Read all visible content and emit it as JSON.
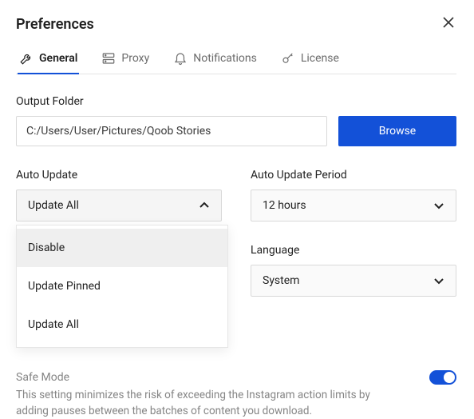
{
  "window": {
    "title": "Preferences"
  },
  "tabs": [
    {
      "id": "general",
      "label": "General",
      "icon": "wrench-icon",
      "active": true
    },
    {
      "id": "proxy",
      "label": "Proxy",
      "icon": "server-icon",
      "active": false
    },
    {
      "id": "notifications",
      "label": "Notifications",
      "icon": "bell-icon",
      "active": false
    },
    {
      "id": "license",
      "label": "License",
      "icon": "key-icon",
      "active": false
    }
  ],
  "output_folder": {
    "label": "Output Folder",
    "value": "C:/Users/User/Pictures/Qoob Stories",
    "browse_label": "Browse"
  },
  "auto_update": {
    "label": "Auto Update",
    "selected": "Update All",
    "open": true,
    "options": [
      "Disable",
      "Update Pinned",
      "Update All"
    ],
    "hovered_option_index": 0
  },
  "auto_update_period": {
    "label": "Auto Update Period",
    "selected": "12 hours"
  },
  "language": {
    "label": "Language",
    "selected": "System"
  },
  "safe_mode": {
    "label": "Safe Mode",
    "enabled": true,
    "description": "This setting minimizes the risk of exceeding the Instagram action limits by adding pauses between the batches of content you download."
  },
  "colors": {
    "accent": "#1351d8"
  }
}
